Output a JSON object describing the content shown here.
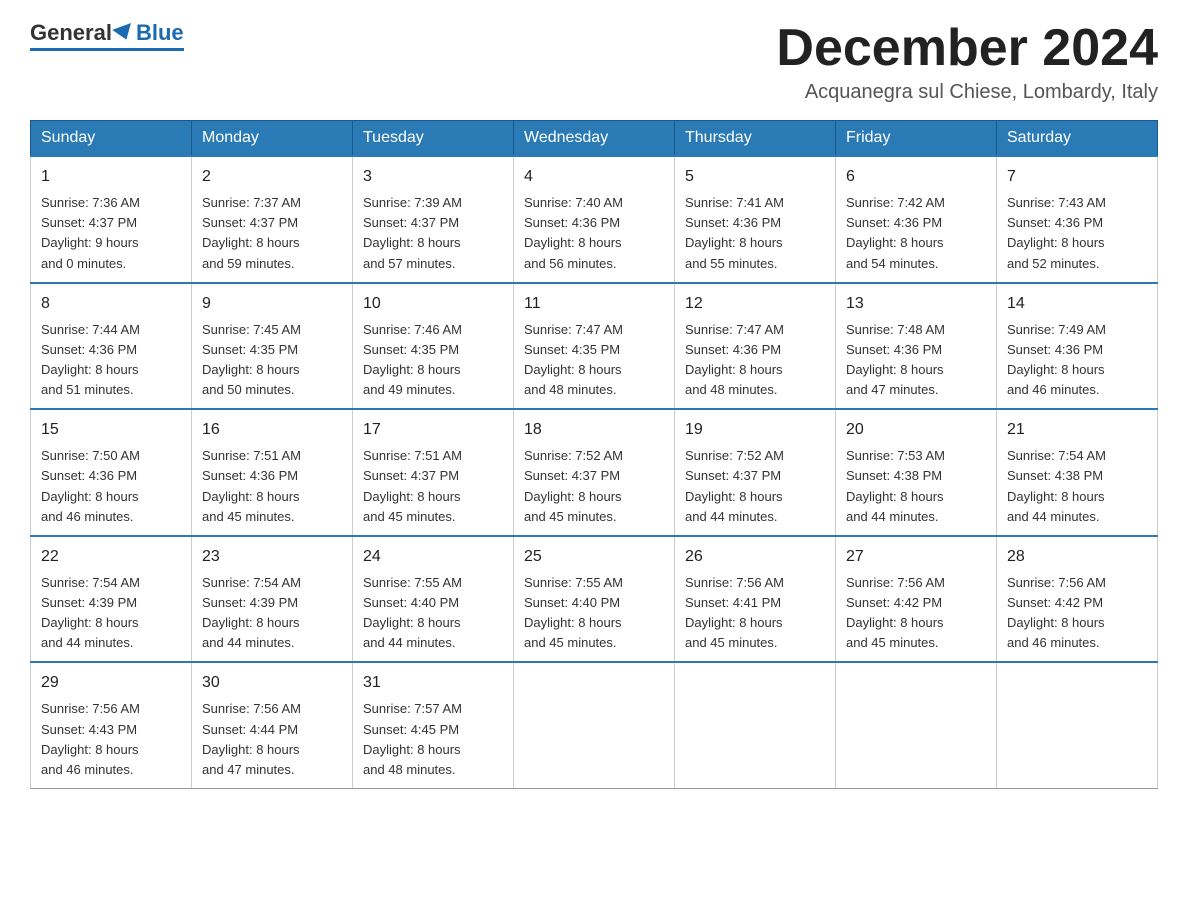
{
  "logo": {
    "general": "General",
    "blue": "Blue"
  },
  "header": {
    "month": "December 2024",
    "location": "Acquanegra sul Chiese, Lombardy, Italy"
  },
  "weekdays": [
    "Sunday",
    "Monday",
    "Tuesday",
    "Wednesday",
    "Thursday",
    "Friday",
    "Saturday"
  ],
  "weeks": [
    [
      {
        "day": "1",
        "sunrise": "7:36 AM",
        "sunset": "4:37 PM",
        "daylight": "9 hours and 0 minutes."
      },
      {
        "day": "2",
        "sunrise": "7:37 AM",
        "sunset": "4:37 PM",
        "daylight": "8 hours and 59 minutes."
      },
      {
        "day": "3",
        "sunrise": "7:39 AM",
        "sunset": "4:37 PM",
        "daylight": "8 hours and 57 minutes."
      },
      {
        "day": "4",
        "sunrise": "7:40 AM",
        "sunset": "4:36 PM",
        "daylight": "8 hours and 56 minutes."
      },
      {
        "day": "5",
        "sunrise": "7:41 AM",
        "sunset": "4:36 PM",
        "daylight": "8 hours and 55 minutes."
      },
      {
        "day": "6",
        "sunrise": "7:42 AM",
        "sunset": "4:36 PM",
        "daylight": "8 hours and 54 minutes."
      },
      {
        "day": "7",
        "sunrise": "7:43 AM",
        "sunset": "4:36 PM",
        "daylight": "8 hours and 52 minutes."
      }
    ],
    [
      {
        "day": "8",
        "sunrise": "7:44 AM",
        "sunset": "4:36 PM",
        "daylight": "8 hours and 51 minutes."
      },
      {
        "day": "9",
        "sunrise": "7:45 AM",
        "sunset": "4:35 PM",
        "daylight": "8 hours and 50 minutes."
      },
      {
        "day": "10",
        "sunrise": "7:46 AM",
        "sunset": "4:35 PM",
        "daylight": "8 hours and 49 minutes."
      },
      {
        "day": "11",
        "sunrise": "7:47 AM",
        "sunset": "4:35 PM",
        "daylight": "8 hours and 48 minutes."
      },
      {
        "day": "12",
        "sunrise": "7:47 AM",
        "sunset": "4:36 PM",
        "daylight": "8 hours and 48 minutes."
      },
      {
        "day": "13",
        "sunrise": "7:48 AM",
        "sunset": "4:36 PM",
        "daylight": "8 hours and 47 minutes."
      },
      {
        "day": "14",
        "sunrise": "7:49 AM",
        "sunset": "4:36 PM",
        "daylight": "8 hours and 46 minutes."
      }
    ],
    [
      {
        "day": "15",
        "sunrise": "7:50 AM",
        "sunset": "4:36 PM",
        "daylight": "8 hours and 46 minutes."
      },
      {
        "day": "16",
        "sunrise": "7:51 AM",
        "sunset": "4:36 PM",
        "daylight": "8 hours and 45 minutes."
      },
      {
        "day": "17",
        "sunrise": "7:51 AM",
        "sunset": "4:37 PM",
        "daylight": "8 hours and 45 minutes."
      },
      {
        "day": "18",
        "sunrise": "7:52 AM",
        "sunset": "4:37 PM",
        "daylight": "8 hours and 45 minutes."
      },
      {
        "day": "19",
        "sunrise": "7:52 AM",
        "sunset": "4:37 PM",
        "daylight": "8 hours and 44 minutes."
      },
      {
        "day": "20",
        "sunrise": "7:53 AM",
        "sunset": "4:38 PM",
        "daylight": "8 hours and 44 minutes."
      },
      {
        "day": "21",
        "sunrise": "7:54 AM",
        "sunset": "4:38 PM",
        "daylight": "8 hours and 44 minutes."
      }
    ],
    [
      {
        "day": "22",
        "sunrise": "7:54 AM",
        "sunset": "4:39 PM",
        "daylight": "8 hours and 44 minutes."
      },
      {
        "day": "23",
        "sunrise": "7:54 AM",
        "sunset": "4:39 PM",
        "daylight": "8 hours and 44 minutes."
      },
      {
        "day": "24",
        "sunrise": "7:55 AM",
        "sunset": "4:40 PM",
        "daylight": "8 hours and 44 minutes."
      },
      {
        "day": "25",
        "sunrise": "7:55 AM",
        "sunset": "4:40 PM",
        "daylight": "8 hours and 45 minutes."
      },
      {
        "day": "26",
        "sunrise": "7:56 AM",
        "sunset": "4:41 PM",
        "daylight": "8 hours and 45 minutes."
      },
      {
        "day": "27",
        "sunrise": "7:56 AM",
        "sunset": "4:42 PM",
        "daylight": "8 hours and 45 minutes."
      },
      {
        "day": "28",
        "sunrise": "7:56 AM",
        "sunset": "4:42 PM",
        "daylight": "8 hours and 46 minutes."
      }
    ],
    [
      {
        "day": "29",
        "sunrise": "7:56 AM",
        "sunset": "4:43 PM",
        "daylight": "8 hours and 46 minutes."
      },
      {
        "day": "30",
        "sunrise": "7:56 AM",
        "sunset": "4:44 PM",
        "daylight": "8 hours and 47 minutes."
      },
      {
        "day": "31",
        "sunrise": "7:57 AM",
        "sunset": "4:45 PM",
        "daylight": "8 hours and 48 minutes."
      },
      null,
      null,
      null,
      null
    ]
  ],
  "labels": {
    "sunrise": "Sunrise:",
    "sunset": "Sunset:",
    "daylight": "Daylight:"
  }
}
